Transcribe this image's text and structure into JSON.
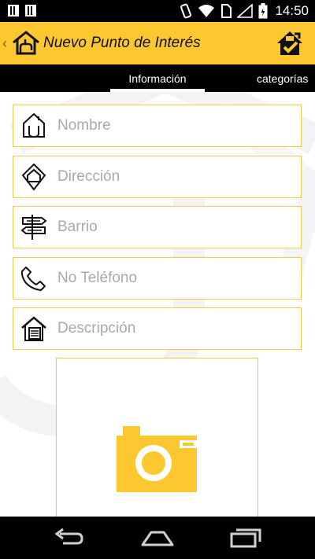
{
  "status_bar": {
    "time": "14:50"
  },
  "action_bar": {
    "title": "Nuevo Punto de Interés",
    "app_icon": "home-hand-icon",
    "save_icon": "home-check-icon",
    "accent_color": "#fcc72f"
  },
  "tabs": [
    {
      "label": "Información",
      "active": true
    },
    {
      "label": "categorías",
      "active": false
    }
  ],
  "form": {
    "fields": [
      {
        "placeholder": "Nombre",
        "value": "",
        "icon": "house-outline-icon"
      },
      {
        "placeholder": "Dirección",
        "value": "",
        "icon": "diamond-house-icon"
      },
      {
        "placeholder": "Barrio",
        "value": "",
        "icon": "signpost-icon"
      },
      {
        "placeholder": "No Teléfono",
        "value": "",
        "icon": "phone-icon"
      },
      {
        "placeholder": "Descripción",
        "value": "",
        "icon": "house-document-icon"
      }
    ],
    "photo_icon": "camera-icon"
  },
  "nav_bar": {
    "back_icon": "back-arrow-icon",
    "home_icon": "home-icon",
    "recents_icon": "recents-icon"
  }
}
